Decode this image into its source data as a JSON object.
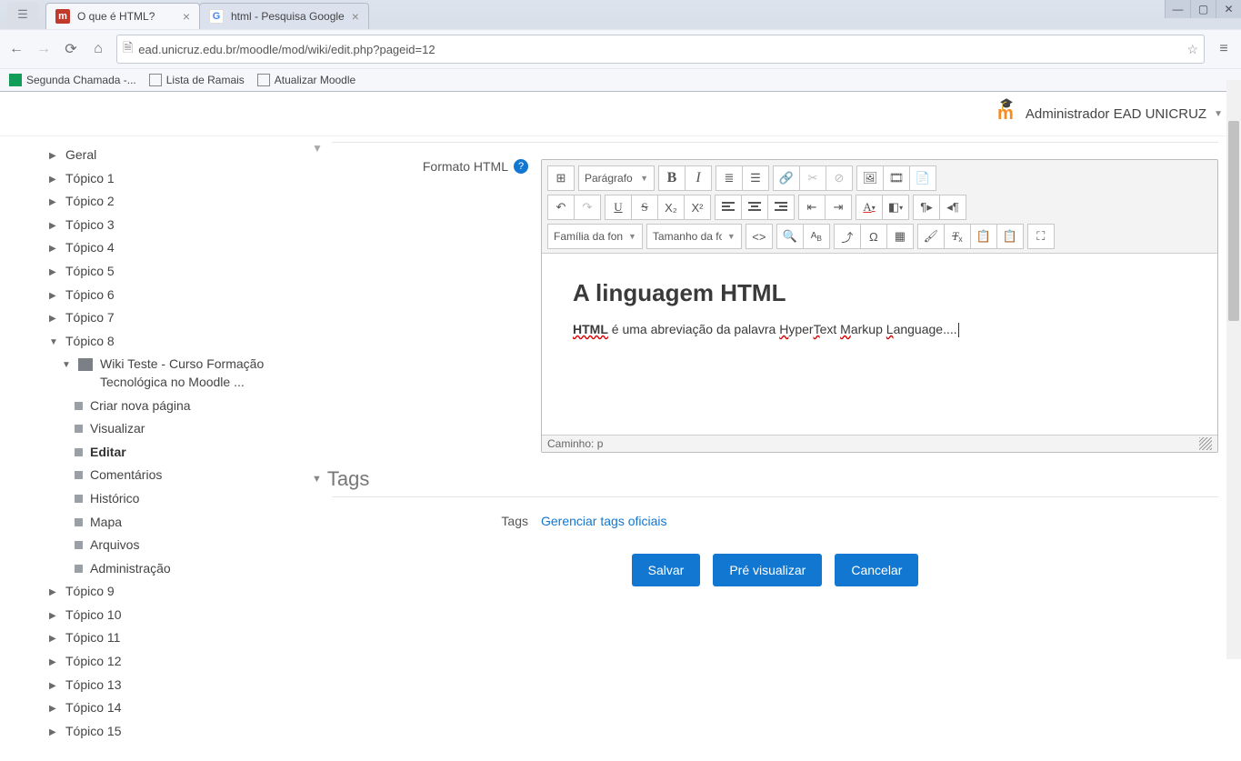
{
  "browser": {
    "tabs": [
      {
        "title": "O que é HTML?",
        "favicon": "m",
        "active": true
      },
      {
        "title": "html - Pesquisa Google",
        "favicon": "g",
        "active": false
      }
    ],
    "url": "ead.unicruz.edu.br/moodle/mod/wiki/edit.php?pageid=12",
    "bookmarks": [
      {
        "label": "Segunda Chamada -...",
        "icon": "sheet"
      },
      {
        "label": "Lista de Ramais",
        "icon": "page"
      },
      {
        "label": "Atualizar Moodle",
        "icon": "page"
      }
    ]
  },
  "user": {
    "name": "Administrador EAD UNICRUZ"
  },
  "sidebar": {
    "items": [
      {
        "label": "Geral",
        "level": 1,
        "caret": "right"
      },
      {
        "label": "Tópico 1",
        "level": 1,
        "caret": "right"
      },
      {
        "label": "Tópico 2",
        "level": 1,
        "caret": "right"
      },
      {
        "label": "Tópico 3",
        "level": 1,
        "caret": "right"
      },
      {
        "label": "Tópico 4",
        "level": 1,
        "caret": "right"
      },
      {
        "label": "Tópico 5",
        "level": 1,
        "caret": "right"
      },
      {
        "label": "Tópico 6",
        "level": 1,
        "caret": "right"
      },
      {
        "label": "Tópico 7",
        "level": 1,
        "caret": "right"
      },
      {
        "label": "Tópico 8",
        "level": 1,
        "caret": "down"
      },
      {
        "label": "Wiki Teste - Curso Formação Tecnológica no Moodle ...",
        "level": 2,
        "caret": "down",
        "wiki": true
      },
      {
        "label": "Criar nova página",
        "level": 3,
        "square": true
      },
      {
        "label": "Visualizar",
        "level": 3,
        "square": true
      },
      {
        "label": "Editar",
        "level": 3,
        "square": true,
        "bold": true
      },
      {
        "label": "Comentários",
        "level": 3,
        "square": true
      },
      {
        "label": "Histórico",
        "level": 3,
        "square": true
      },
      {
        "label": "Mapa",
        "level": 3,
        "square": true
      },
      {
        "label": "Arquivos",
        "level": 3,
        "square": true
      },
      {
        "label": "Administração",
        "level": 3,
        "square": true
      },
      {
        "label": "Tópico 9",
        "level": 1,
        "caret": "right"
      },
      {
        "label": "Tópico 10",
        "level": 1,
        "caret": "right"
      },
      {
        "label": "Tópico 11",
        "level": 1,
        "caret": "right"
      },
      {
        "label": "Tópico 12",
        "level": 1,
        "caret": "right"
      },
      {
        "label": "Tópico 13",
        "level": 1,
        "caret": "right"
      },
      {
        "label": "Tópico 14",
        "level": 1,
        "caret": "right"
      },
      {
        "label": "Tópico 15",
        "level": 1,
        "caret": "right"
      }
    ]
  },
  "form": {
    "format_label": "Formato HTML",
    "tags_section": "Tags",
    "tags_label": "Tags",
    "manage_tags": "Gerenciar tags oficiais",
    "buttons": {
      "save": "Salvar",
      "preview": "Pré visualizar",
      "cancel": "Cancelar"
    }
  },
  "editor": {
    "paragraph_sel": "Parágrafo",
    "font_family_sel": "Família da font",
    "font_size_sel": "Tamanho da fon",
    "path_label": "Caminho: p",
    "content": {
      "heading": "A linguagem HTML",
      "para_prefix": "HTML",
      "para_mid1": " é uma abreviação da palavra ",
      "para_h": "H",
      "para_t1": "yper",
      "para_T": "T",
      "para_t2": "ext ",
      "para_M": "M",
      "para_t3": "arkup ",
      "para_L": "L",
      "para_t4": "anguage...."
    }
  }
}
